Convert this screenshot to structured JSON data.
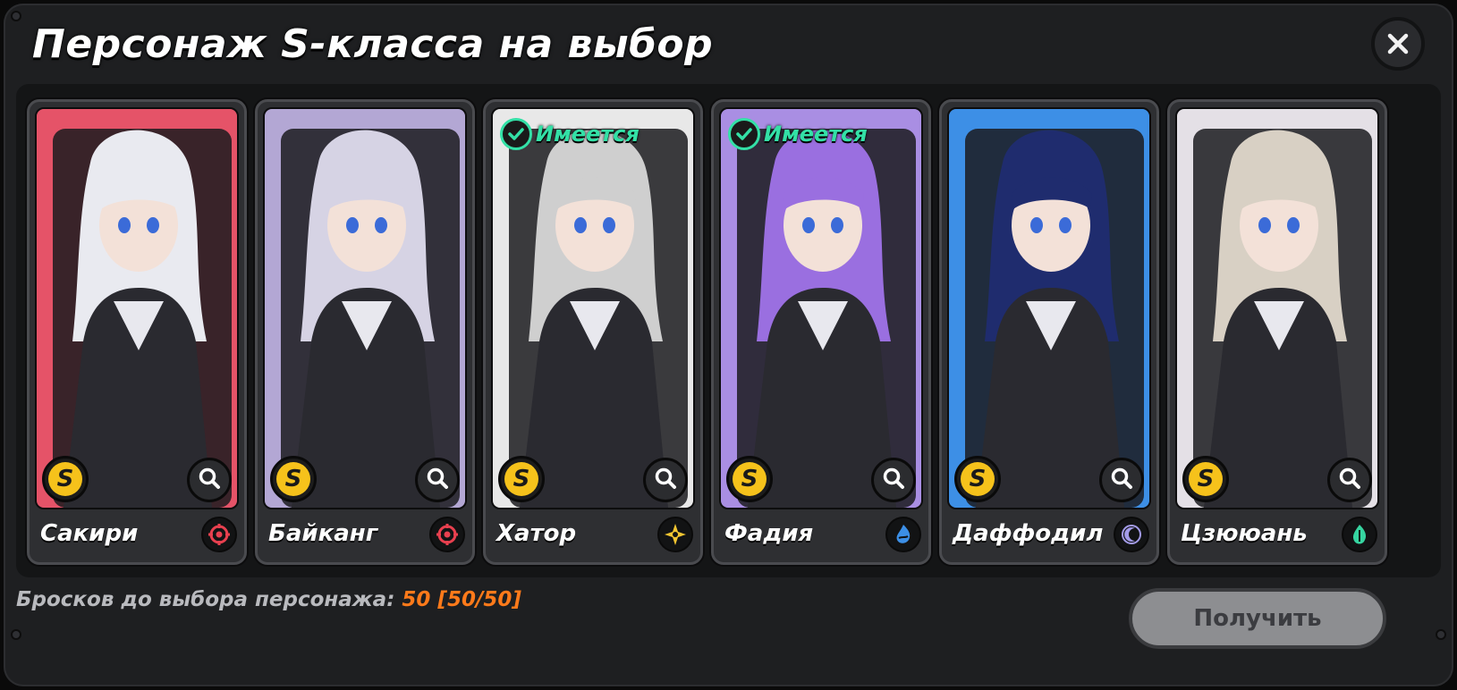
{
  "dialog": {
    "title": "Персонаж S-класса на выбор",
    "close_icon": "close-icon"
  },
  "cards": [
    {
      "name": "Сакири",
      "owned": false,
      "rank": "S",
      "element_icon": "target-crosshair-icon",
      "element_color": "#e8404f",
      "bg": "#e55368",
      "hair": "#e9eaf0"
    },
    {
      "name": "Байканг",
      "owned": false,
      "rank": "S",
      "element_icon": "target-crosshair-icon",
      "element_color": "#e8404f",
      "bg": "#b3a7d4",
      "hair": "#d6d3e4"
    },
    {
      "name": "Хатор",
      "owned": true,
      "owned_label": "Имеется",
      "rank": "S",
      "element_icon": "star-burst-icon",
      "element_color": "#f2c531",
      "bg": "#e8e8e8",
      "hair": "#cfcfcf"
    },
    {
      "name": "Фадия",
      "owned": true,
      "owned_label": "Имеется",
      "rank": "S",
      "element_icon": "water-flame-icon",
      "element_color": "#3c8fe6",
      "bg": "#a98ee3",
      "hair": "#9a6fe0"
    },
    {
      "name": "Даффодил",
      "owned": false,
      "rank": "S",
      "element_icon": "crescent-moon-icon",
      "element_color": "#a39be8",
      "bg": "#3d8fe6",
      "hair": "#1f2c6e"
    },
    {
      "name": "Цзююань",
      "owned": false,
      "rank": "S",
      "element_icon": "leaf-drop-icon",
      "element_color": "#36d4a0",
      "bg": "#e4e0e6",
      "hair": "#d8d0c4"
    }
  ],
  "footer": {
    "pity_label": "Бросков до выбора персонажа:",
    "pity_value": "50 [50/50]",
    "receive_button": "Получить"
  },
  "colors": {
    "accent_owned": "#33e0a6",
    "pity_highlight": "#ff7a1a",
    "rank_gold": "#f6c21b"
  }
}
